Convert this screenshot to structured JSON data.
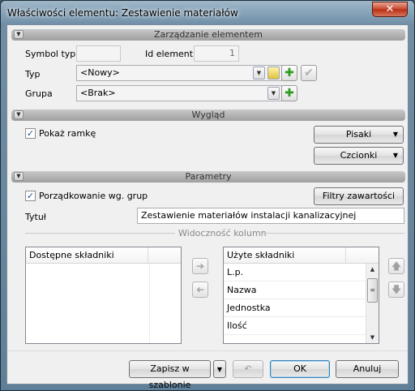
{
  "window": {
    "title": "Właściwości elementu: Zestawienie materiałów",
    "close_glyph": "✕"
  },
  "sections": {
    "management": "Zarządzanie elementem",
    "appearance": "Wygląd",
    "parameters": "Parametry"
  },
  "management": {
    "symbol_label": "Symbol typu",
    "symbol_value": "",
    "id_label": "Id elementu",
    "id_value": "1",
    "type_label": "Typ",
    "type_value": "<Nowy>",
    "group_label": "Grupa",
    "group_value": "<Brak>"
  },
  "appearance": {
    "show_frame_label": "Pokaż ramkę",
    "show_frame_checked": true,
    "pens_button": "Pisaki",
    "fonts_button": "Czcionki"
  },
  "parameters": {
    "group_sort_label": "Porządkowanie wg. grup",
    "group_sort_checked": true,
    "filters_button": "Filtry zawartości",
    "title_label": "Tytuł",
    "title_value": "Zestawienie materiałów instalacji kanalizacyjnej",
    "columns_group_label": "Widoczność kolumn"
  },
  "available_list": {
    "header": "Dostępne składniki",
    "items": []
  },
  "used_list": {
    "header": "Użyte składniki",
    "items": [
      "L.p.",
      "Nazwa",
      "Jednostka",
      "Ilość"
    ]
  },
  "footer": {
    "save_template": "Zapisz w szablonie",
    "ok": "OK",
    "cancel": "Anuluj"
  },
  "colors": {
    "add_green": "#2e9a1f",
    "title_bar": "#6f8ea6",
    "close_red": "#c8432a"
  }
}
